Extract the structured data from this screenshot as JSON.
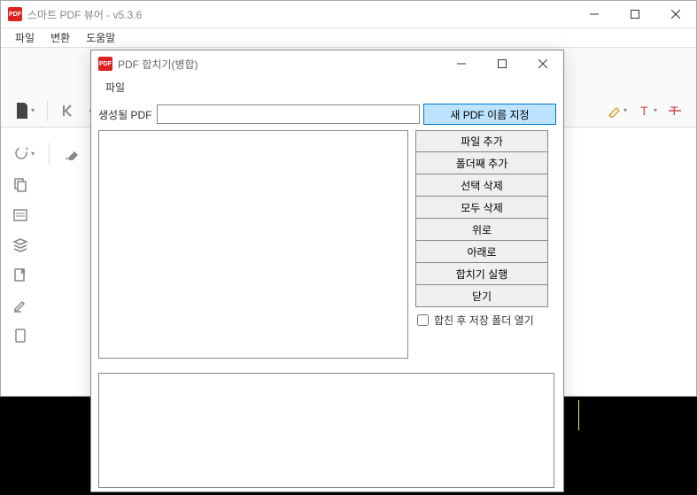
{
  "mainWindow": {
    "iconText": "PDF",
    "title": "스마트 PDF 뷰어 - v5.3.6",
    "menu": {
      "file": "파일",
      "convert": "변환",
      "help": "도움말"
    }
  },
  "dialog": {
    "iconText": "PDF",
    "title": "PDF 합치기(병합)",
    "menu": {
      "file": "파일"
    },
    "outputLabel": "생성될 PDF",
    "outputValue": "",
    "buttons": {
      "newName": "새 PDF 이름 지정",
      "addFile": "파일 추가",
      "addFolder": "폴더째 추가",
      "removeSel": "선택 삭제",
      "removeAll": "모두 삭제",
      "moveUp": "위로",
      "moveDown": "아래로",
      "merge": "합치기 실행",
      "close": "닫기"
    },
    "openFolderAfter": "합친 후 저장 폴더 열기"
  }
}
